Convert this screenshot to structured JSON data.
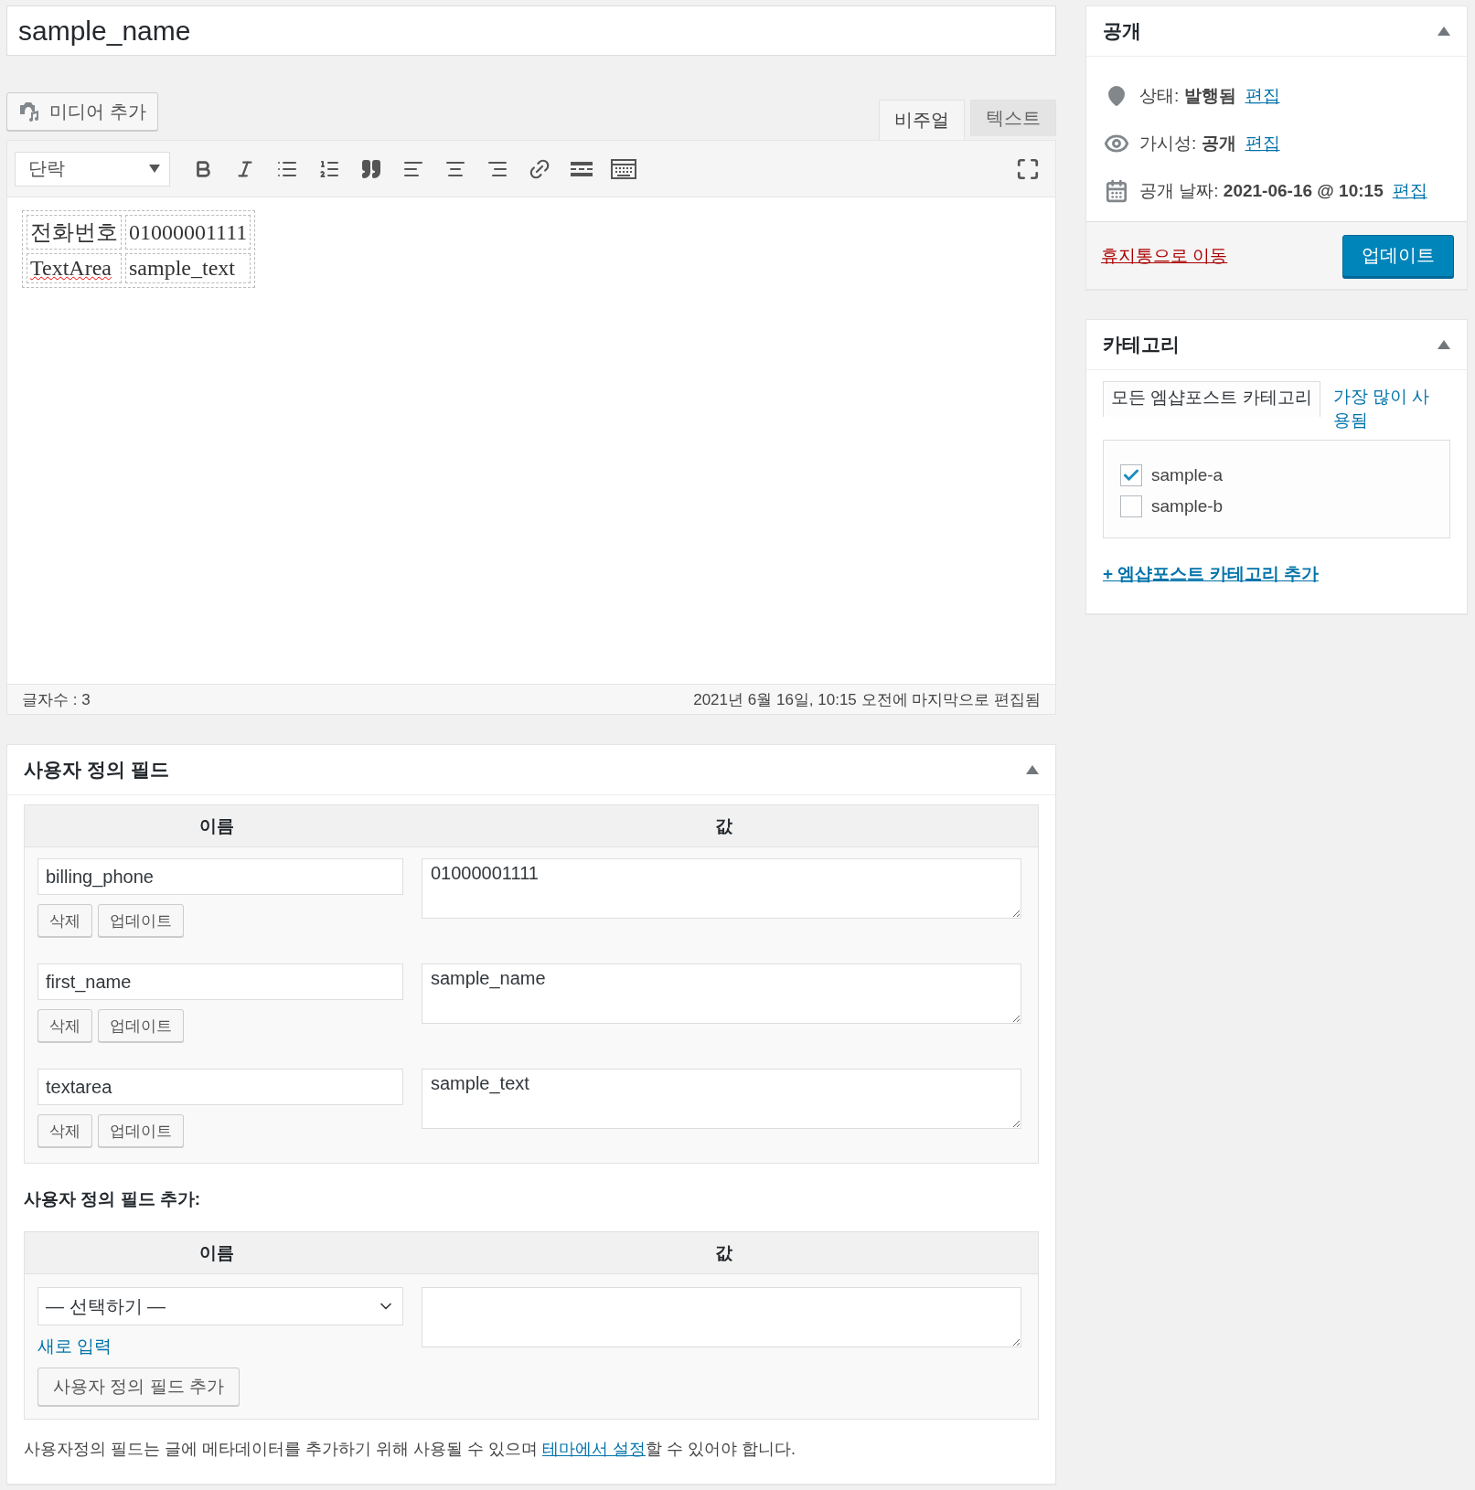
{
  "title_field": {
    "value": "sample_name"
  },
  "media_button": {
    "label": "미디어 추가"
  },
  "editor_tabs": [
    {
      "label": "비주얼",
      "selected": true
    },
    {
      "label": "텍스트",
      "selected": false
    }
  ],
  "format_select": {
    "value": "단락"
  },
  "content_table": {
    "rows": [
      [
        {
          "text": "전화번호",
          "misspelled": false
        },
        {
          "text": "01000001111",
          "misspelled": false
        }
      ],
      [
        {
          "text": "TextArea",
          "misspelled": true
        },
        {
          "text": "sample_text",
          "misspelled": false
        }
      ]
    ]
  },
  "word_count": "글자수 : 3",
  "last_edited": "2021년 6월 16일, 10:15 오전에 마지막으로 편집됨",
  "custom_fields": {
    "title": "사용자 정의 필드",
    "columns": [
      "이름",
      "값"
    ],
    "rows": [
      {
        "name": "billing_phone",
        "value": "01000001111",
        "delete": "삭제",
        "update": "업데이트"
      },
      {
        "name": "first_name",
        "value": "sample_name",
        "delete": "삭제",
        "update": "업데이트"
      },
      {
        "name": "textarea",
        "value": "sample_text",
        "delete": "삭제",
        "update": "업데이트"
      }
    ],
    "add_title": "사용자 정의 필드 추가:",
    "add_columns": [
      "이름",
      "값"
    ],
    "select": {
      "value": "— 선택하기 —"
    },
    "new_link": "새로 입력",
    "add_button": "사용자 정의 필드 추가",
    "note": {
      "before": "사용자정의 필드는 글에 메타데이터를 추가하기 위해 사용될 수 있으며 ",
      "link": "테마에서 설정",
      "after": "할 수 있어야 합니다."
    }
  },
  "publish": {
    "title": "공개",
    "rows": [
      {
        "kind": "status",
        "text": "상태: **발행됨**",
        "link": "편집"
      },
      {
        "kind": "visibility",
        "text": "가시성: **공개**",
        "link": "편집"
      },
      {
        "kind": "date",
        "text": "공개 날짜: **2021-06-16 @ 10:15**",
        "link": "편집"
      }
    ],
    "trash_link": "휴지통으로 이동",
    "update_button": "업데이트"
  },
  "categories": {
    "title": "카테고리",
    "tabs": [
      {
        "label": "모든 엠샵포스트 카테고리",
        "selected": true
      },
      {
        "label": "가장 많이 사용됨",
        "selected": false
      }
    ],
    "items": [
      {
        "label": "sample-a",
        "checked": true
      },
      {
        "label": "sample-b",
        "checked": false
      }
    ],
    "add_link": "+ 엠샵포스트 카테고리 추가"
  }
}
